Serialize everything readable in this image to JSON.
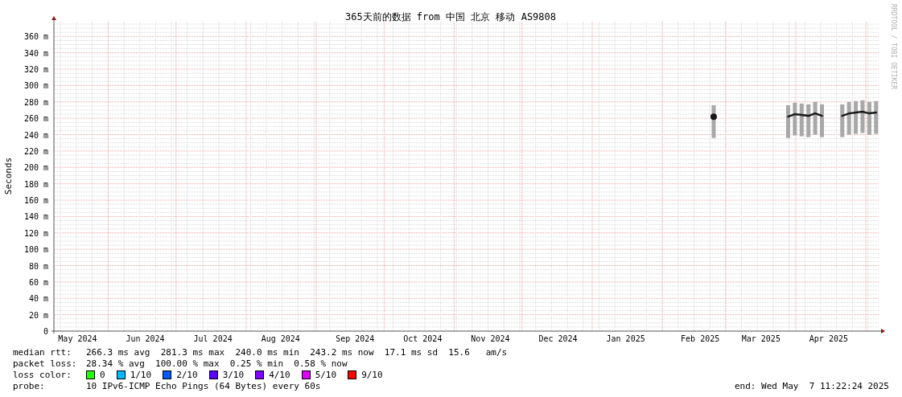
{
  "title": "365天前的数据 from 中国 北京 移动 AS9808",
  "credit": "RRDTOOL / TOBI OETIKER",
  "chart_data": {
    "type": "line",
    "ylabel": "Seconds",
    "ylim": [
      0,
      378
    ],
    "yticks": [
      {
        "value": 0,
        "label": "0"
      },
      {
        "value": 20,
        "label": "20 m"
      },
      {
        "value": 40,
        "label": "40 m"
      },
      {
        "value": 60,
        "label": "60 m"
      },
      {
        "value": 80,
        "label": "80 m"
      },
      {
        "value": 100,
        "label": "100 m"
      },
      {
        "value": 120,
        "label": "120 m"
      },
      {
        "value": 140,
        "label": "140 m"
      },
      {
        "value": 160,
        "label": "160 m"
      },
      {
        "value": 180,
        "label": "180 m"
      },
      {
        "value": 200,
        "label": "200 m"
      },
      {
        "value": 220,
        "label": "220 m"
      },
      {
        "value": 240,
        "label": "240 m"
      },
      {
        "value": 260,
        "label": "260 m"
      },
      {
        "value": 280,
        "label": "280 m"
      },
      {
        "value": 300,
        "label": "300 m"
      },
      {
        "value": 320,
        "label": "320 m"
      },
      {
        "value": 340,
        "label": "340 m"
      },
      {
        "value": 360,
        "label": "360 m"
      }
    ],
    "categories": [
      null,
      null,
      null,
      "May 2024",
      null,
      null,
      null,
      null,
      null,
      null,
      null,
      null,
      null,
      "Jun 2024",
      null,
      null,
      null,
      null,
      null,
      null,
      null,
      null,
      null,
      "Jul 2024",
      null,
      null,
      null,
      null,
      null,
      null,
      null,
      null,
      null,
      "Aug 2024",
      null,
      null,
      null,
      null,
      null,
      null,
      null,
      null,
      null,
      null,
      "Sep 2024",
      null,
      null,
      null,
      null,
      null,
      null,
      null,
      null,
      null,
      "Oct 2024",
      null,
      null,
      null,
      null,
      null,
      null,
      null,
      null,
      null,
      "Nov 2024",
      null,
      null,
      null,
      null,
      null,
      null,
      null,
      null,
      null,
      "Dec 2024",
      null,
      null,
      null,
      null,
      null,
      null,
      null,
      null,
      null,
      "Jan 2025",
      null,
      null,
      null,
      null,
      null,
      null,
      null,
      null,
      null,
      null,
      "Feb 2025",
      null,
      null,
      null,
      null,
      null,
      null,
      null,
      null,
      "Mar 2025",
      null,
      null,
      null,
      null,
      null,
      null,
      null,
      null,
      null,
      "Apr 2025",
      null,
      null,
      null,
      null,
      null,
      null,
      null
    ],
    "series": [
      {
        "name": "median rtt:",
        "color": "#1a1a1a",
        "values": [
          null,
          null,
          null,
          null,
          null,
          null,
          null,
          null,
          null,
          null,
          null,
          null,
          null,
          null,
          null,
          null,
          null,
          null,
          null,
          null,
          null,
          null,
          null,
          null,
          null,
          null,
          null,
          null,
          null,
          null,
          null,
          null,
          null,
          null,
          null,
          null,
          null,
          null,
          null,
          null,
          null,
          null,
          null,
          null,
          null,
          null,
          null,
          null,
          null,
          null,
          null,
          null,
          null,
          null,
          null,
          null,
          null,
          null,
          null,
          null,
          null,
          null,
          null,
          null,
          null,
          null,
          null,
          null,
          null,
          null,
          null,
          null,
          null,
          null,
          null,
          null,
          null,
          null,
          null,
          null,
          null,
          null,
          null,
          null,
          null,
          null,
          null,
          null,
          null,
          null,
          null,
          null,
          null,
          null,
          null,
          null,
          null,
          262,
          null,
          null,
          null,
          null,
          null,
          null,
          null,
          null,
          null,
          null,
          262,
          265,
          264,
          263,
          266,
          263,
          null,
          null,
          263,
          266,
          267,
          268,
          266,
          267
        ],
        "errors": [
          null,
          null,
          null,
          null,
          null,
          null,
          null,
          null,
          null,
          null,
          null,
          null,
          null,
          null,
          null,
          null,
          null,
          null,
          null,
          null,
          null,
          null,
          null,
          null,
          null,
          null,
          null,
          null,
          null,
          null,
          null,
          null,
          null,
          null,
          null,
          null,
          null,
          null,
          null,
          null,
          null,
          null,
          null,
          null,
          null,
          null,
          null,
          null,
          null,
          null,
          null,
          null,
          null,
          null,
          null,
          null,
          null,
          null,
          null,
          null,
          null,
          null,
          null,
          null,
          null,
          null,
          null,
          null,
          null,
          null,
          null,
          null,
          null,
          null,
          null,
          null,
          null,
          null,
          null,
          null,
          null,
          null,
          null,
          null,
          null,
          null,
          null,
          null,
          null,
          null,
          null,
          null,
          null,
          null,
          null,
          null,
          null,
          [
            236,
            276
          ],
          null,
          null,
          null,
          null,
          null,
          null,
          null,
          null,
          null,
          null,
          [
            236,
            276
          ],
          [
            239,
            279
          ],
          [
            238,
            278
          ],
          [
            237,
            277
          ],
          [
            240,
            280
          ],
          [
            237,
            277
          ],
          null,
          null,
          [
            237,
            277
          ],
          [
            240,
            280
          ],
          [
            241,
            281
          ],
          [
            242,
            282
          ],
          [
            240,
            280
          ],
          [
            241,
            281
          ]
        ]
      }
    ],
    "grid": true
  },
  "stats": [
    {
      "text": "266.3 ms avg  281.3 ms max  240.0 ms min  243.2 ms now  17.1 ms sd  15.6   am/s"
    },
    {
      "label": "packet loss:",
      "text": "28.34 % avg  100.00 % max  0.25 % min  0.58 % now"
    }
  ],
  "loss_label": "loss color:",
  "loss_colors": [
    {
      "label": "0",
      "color": "#26ff00"
    },
    {
      "label": "1/10",
      "color": "#00b8ff"
    },
    {
      "label": "2/10",
      "color": "#0059ff"
    },
    {
      "label": "3/10",
      "color": "#5e00ff"
    },
    {
      "label": "4/10",
      "color": "#7e00ff"
    },
    {
      "label": "5/10",
      "color": "#dd00ff"
    },
    {
      "label": "9/10",
      "color": "#ff0000"
    }
  ],
  "probe": {
    "label": "probe:",
    "text": "10 IPv6-ICMP Echo Pings (64 Bytes) every 60s"
  },
  "end": "end: Wed May  7 11:22:24 2025"
}
